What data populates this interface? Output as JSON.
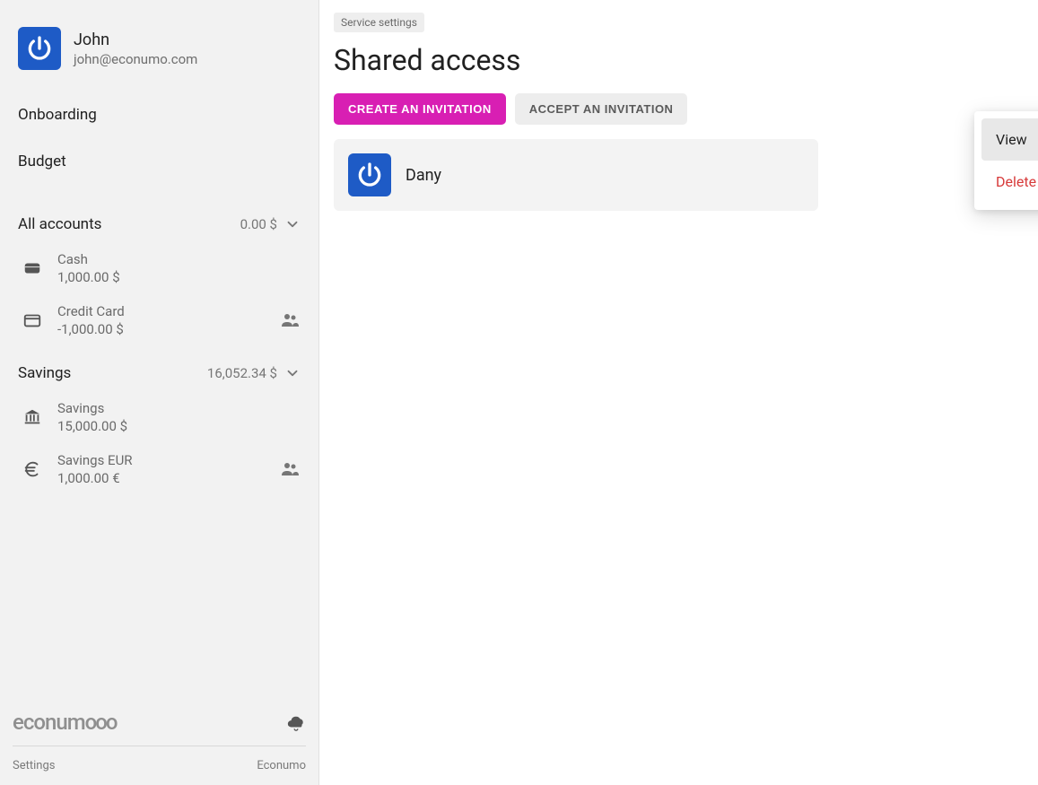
{
  "profile": {
    "name": "John",
    "email": "john@econumo.com"
  },
  "nav": {
    "onboarding": "Onboarding",
    "budget": "Budget"
  },
  "account_groups": [
    {
      "label": "All accounts",
      "total": "0.00 $",
      "items": [
        {
          "name": "Cash",
          "balance": "1,000.00 $",
          "icon": "wallet",
          "shared": false
        },
        {
          "name": "Credit Card",
          "balance": "-1,000.00 $",
          "icon": "card",
          "shared": true
        }
      ]
    },
    {
      "label": "Savings",
      "total": "16,052.34 $",
      "items": [
        {
          "name": "Savings",
          "balance": "15,000.00 $",
          "icon": "bank",
          "shared": false
        },
        {
          "name": "Savings EUR",
          "balance": "1,000.00 €",
          "icon": "euro",
          "shared": true
        }
      ]
    }
  ],
  "brand": {
    "name": "econum",
    "suffix": "ooo"
  },
  "footer": {
    "settings": "Settings",
    "app_name": "Econumo"
  },
  "main": {
    "tag": "Service settings",
    "title": "Shared access",
    "create_btn": "CREATE AN INVITATION",
    "accept_btn": "ACCEPT AN INVITATION",
    "shared_user": "Dany"
  },
  "context_menu": {
    "view": "View",
    "delete": "Delete"
  }
}
